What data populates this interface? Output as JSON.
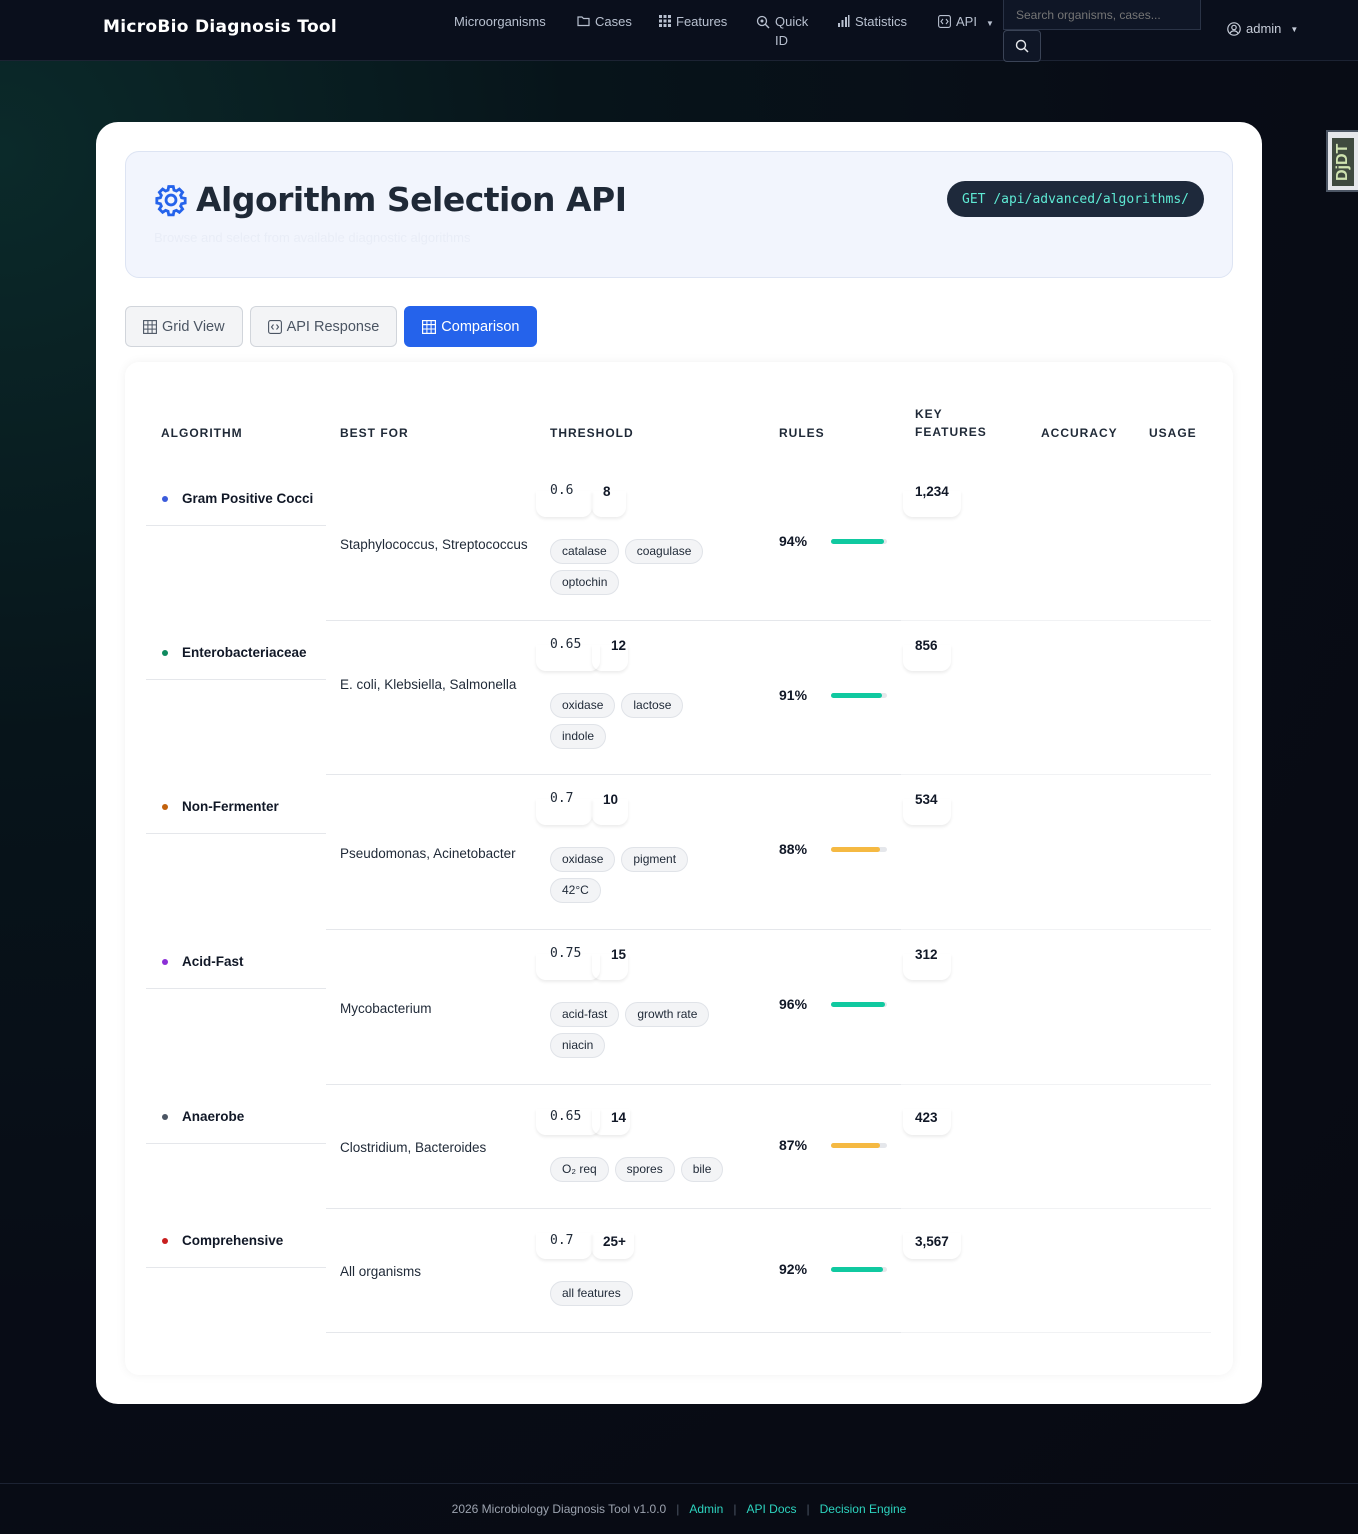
{
  "nav": {
    "brand": "MicroBio Diagnosis Tool",
    "items": [
      {
        "label": "Microorganisms",
        "icon": ""
      },
      {
        "label": "Cases",
        "icon": "folder-icon"
      },
      {
        "label": "Features",
        "icon": "grid-icon"
      },
      {
        "label": "Quick ID",
        "icon": "search-check-icon"
      },
      {
        "label": "Statistics",
        "icon": "bar-chart-icon"
      },
      {
        "label": "API",
        "icon": "code-icon"
      }
    ],
    "search_placeholder": "Search organisms, cases...",
    "user": "admin"
  },
  "side_tab": "DjDT",
  "header": {
    "title": "Algorithm Selection API",
    "subtitle": "Browse and select from available diagnostic algorithms",
    "endpoint": "GET /api/advanced/algorithms/"
  },
  "tabs": [
    {
      "label": "Grid View",
      "active": false
    },
    {
      "label": "API Response",
      "active": false
    },
    {
      "label": "Comparison",
      "active": true
    }
  ],
  "table": {
    "headers": {
      "algorithm": "ALGORITHM",
      "best_for": "BEST FOR",
      "threshold": "THRESHOLD",
      "rules": "RULES",
      "key_features": "KEY FEATURES",
      "accuracy": "ACCURACY",
      "usage": "USAGE"
    },
    "rows": [
      {
        "name": "Gram Positive Cocci",
        "dot": "#3b5bdb",
        "best_for": "Staphylococcus, Streptococcus",
        "threshold": "0.6",
        "rules": "8",
        "tags": [
          "catalase",
          "coagulase",
          "optochin"
        ],
        "accuracy": "94%",
        "accuracy_value": 94,
        "bar_color": "#10c9a0",
        "usage": "1,234"
      },
      {
        "name": "Enterobacteriaceae",
        "dot": "#0f8a5f",
        "best_for": "E. coli, Klebsiella, Salmonella",
        "threshold": "0.65",
        "rules": "12",
        "tags": [
          "oxidase",
          "lactose",
          "indole"
        ],
        "accuracy": "91%",
        "accuracy_value": 91,
        "bar_color": "#10c9a0",
        "usage": "856"
      },
      {
        "name": "Non-Fermenter",
        "dot": "#c2610c",
        "best_for": "Pseudomonas, Acinetobacter",
        "threshold": "0.7",
        "rules": "10",
        "tags": [
          "oxidase",
          "pigment",
          "42°C"
        ],
        "accuracy": "88%",
        "accuracy_value": 88,
        "bar_color": "#f5b942",
        "usage": "534"
      },
      {
        "name": "Acid-Fast",
        "dot": "#8b2fd6",
        "best_for": "Mycobacterium",
        "threshold": "0.75",
        "rules": "15",
        "tags": [
          "acid-fast",
          "growth rate",
          "niacin"
        ],
        "accuracy": "96%",
        "accuracy_value": 96,
        "bar_color": "#10c9a0",
        "usage": "312"
      },
      {
        "name": "Anaerobe",
        "dot": "#4b5563",
        "best_for": "Clostridium, Bacteroides",
        "threshold": "0.65",
        "rules": "14",
        "tags": [
          "O₂ req",
          "spores",
          "bile"
        ],
        "accuracy": "87%",
        "accuracy_value": 87,
        "bar_color": "#f5b942",
        "usage": "423"
      },
      {
        "name": "Comprehensive",
        "dot": "#c81e1e",
        "best_for": "All organisms",
        "threshold": "0.7",
        "rules": "25+",
        "tags": [
          "all features"
        ],
        "accuracy": "92%",
        "accuracy_value": 92,
        "bar_color": "#10c9a0",
        "usage": "3,567"
      }
    ]
  },
  "footer": {
    "copyright": "2026 Microbiology Diagnosis Tool v1.0.0",
    "links": [
      "Admin",
      "API Docs",
      "Decision Engine"
    ]
  }
}
